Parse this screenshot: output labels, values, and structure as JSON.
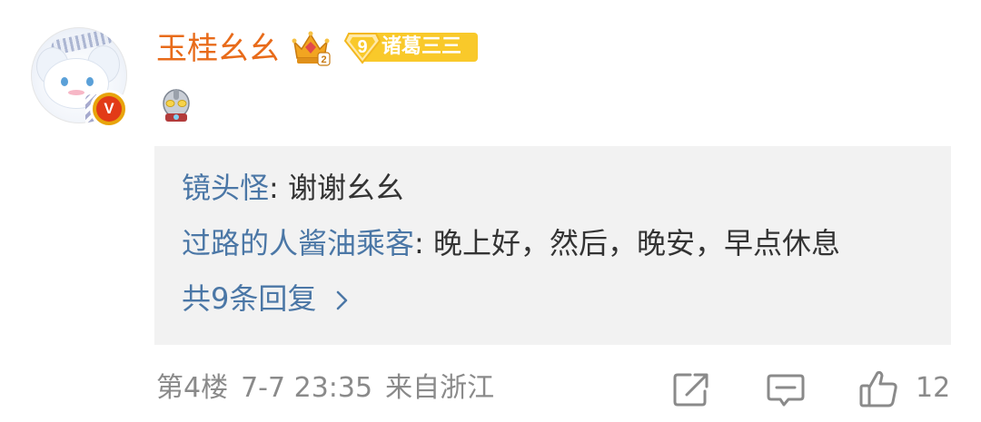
{
  "comment": {
    "username": "玉桂幺幺",
    "fan_badge": {
      "level": "9",
      "label": "诸葛三三"
    },
    "replies": [
      {
        "user": "镜头怪",
        "separator": ": ",
        "text": "谢谢幺幺"
      },
      {
        "user": "过路的人酱油乘客",
        "separator": ": ",
        "text": "晚上好，然后，晚安，早点休息"
      }
    ],
    "more_replies_label": "共9条回复",
    "floor": "第4楼",
    "time": "7-7 23:35",
    "location": "来自浙江",
    "like_count": "12"
  },
  "colors": {
    "username": "#e86b1a",
    "reply_user": "#4b77a6",
    "reply_text": "#333333",
    "meta": "#8a8a8a",
    "reply_bg": "#f2f2f2",
    "badge": "#f9c92a",
    "verified": "#e23b17"
  },
  "icons": [
    "avatar",
    "verified-badge-icon",
    "crown-vip-icon",
    "fan-level-icon",
    "ultraman-badge-icon",
    "chevron-right-icon",
    "share-icon",
    "comment-icon",
    "thumbs-up-icon"
  ]
}
